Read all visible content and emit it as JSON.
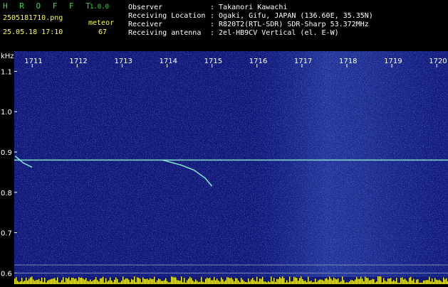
{
  "app": {
    "title": "H R O F F T",
    "version": "1.0.0"
  },
  "capture": {
    "filename": "2505181710.png",
    "datetime": "25.05.18 17:10",
    "meteor_label": "meteor",
    "meteor_count": "67"
  },
  "station": [
    {
      "label": "Observer",
      "value": ": Takanori Kawachi"
    },
    {
      "label": "Receiving Location",
      "value": ": Ogaki, Gifu, JAPAN (136.60E, 35.35N)"
    },
    {
      "label": "Receiver",
      "value": ": R820T2(RTL-SDR) SDR-Sharp 53.372MHz"
    },
    {
      "label": "Receiving antenna",
      "value": ": 2el-HB9CV Vertical (el. E-W)"
    }
  ],
  "colors": {
    "background": "#10187a",
    "signal": "#8cf0d0",
    "grid": "#7a8ab8",
    "bars": "#ffff00"
  },
  "chart_data": {
    "type": "heatmap",
    "ylabel": "kHz",
    "x_ticks": [
      "1711",
      "1712",
      "1713",
      "1714",
      "1715",
      "1716",
      "1717",
      "1718",
      "1719",
      "1720"
    ],
    "y_ticks": [
      "1.1",
      "1.0",
      "0.9",
      "0.8",
      "0.7",
      "0.6"
    ],
    "ylim": [
      0.59,
      1.15
    ],
    "x_range": [
      1710.6,
      1720.25
    ],
    "carrier_khz": 0.88,
    "meteor_traces": [
      {
        "points": [
          [
            1713.9,
            0.88
          ],
          [
            1714.3,
            0.868
          ],
          [
            1714.6,
            0.855
          ],
          [
            1714.85,
            0.835
          ],
          [
            1715.0,
            0.815
          ]
        ]
      },
      {
        "points": [
          [
            1710.62,
            0.89
          ],
          [
            1710.8,
            0.873
          ],
          [
            1711.0,
            0.862
          ]
        ]
      }
    ],
    "reference_lines_khz": [
      0.62,
      0.6
    ]
  }
}
